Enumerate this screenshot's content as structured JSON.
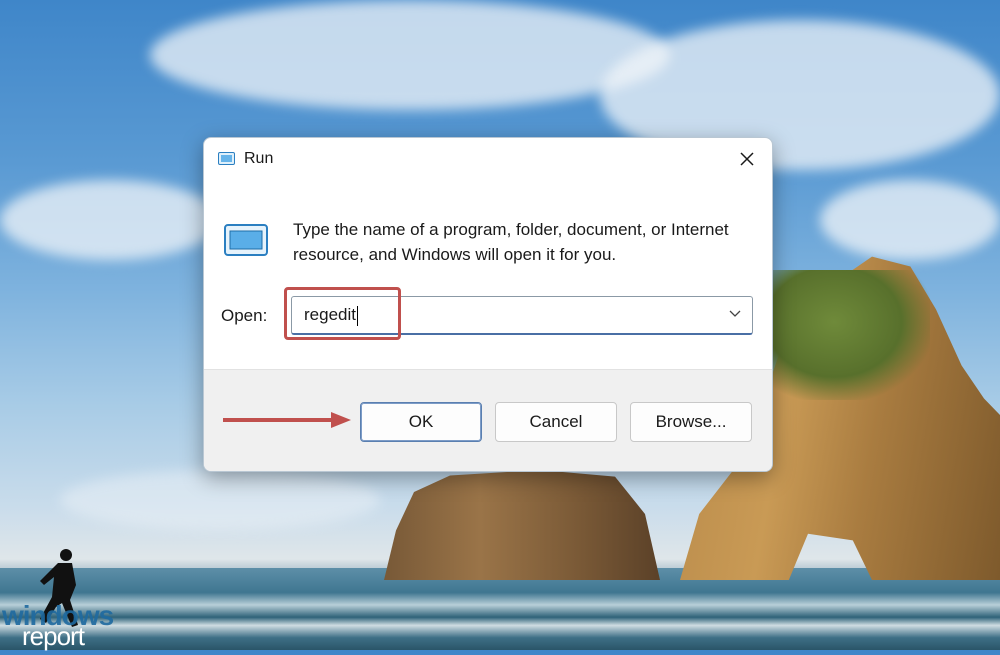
{
  "dialog": {
    "title": "Run",
    "close_glyph": "✕",
    "description": "Type the name of a program, folder, document, or Internet resource, and Windows will open it for you.",
    "open_label": "Open:",
    "open_value": "regedit",
    "buttons": {
      "ok": "OK",
      "cancel": "Cancel",
      "browse": "Browse..."
    }
  },
  "watermark": {
    "line1": "windows",
    "line2": "report"
  },
  "icons": [
    "run-app-icon",
    "close-icon",
    "chevron-down-icon"
  ],
  "colors": {
    "highlight": "#c0504d",
    "accent": "#4a6fa5"
  }
}
